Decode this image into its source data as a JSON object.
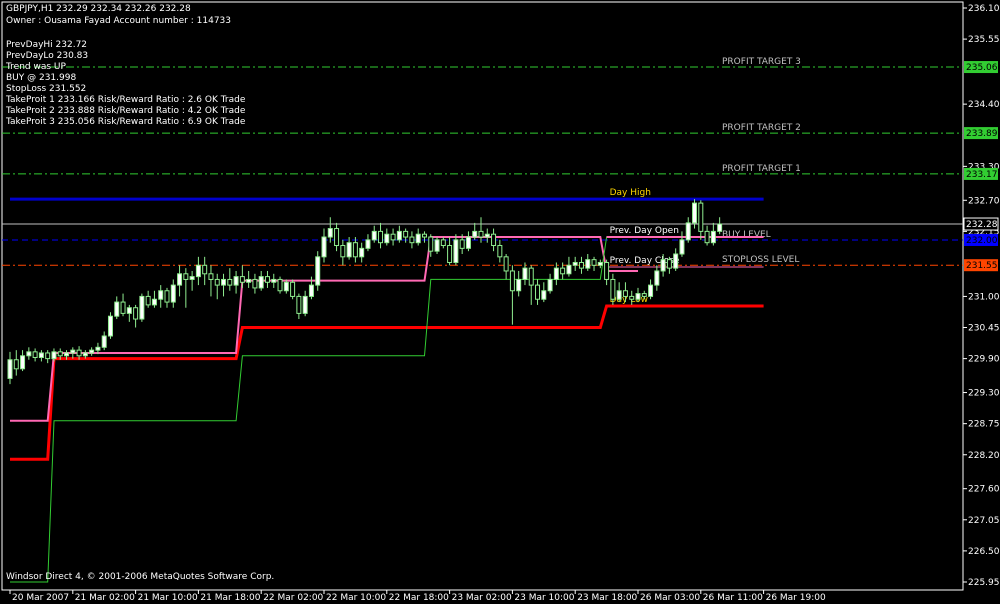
{
  "header": {
    "symbol_line": "GBPJPY,H1  232.29 232.34 232.26 232.28",
    "owner_line": "Owner : Ousama Fayad Account number : 114733",
    "info_lines": [
      "PrevDayHi 232.72",
      "PrevDayLo 230.83",
      "Trend was UP",
      "BUY @ 231.998",
      "StopLoss 231.552",
      "TakeProit 1 233.166 Risk/Reward Ratio : 2.6 OK Trade",
      "TakeProit 2 233.888 Risk/Reward Ratio : 4.2 OK Trade",
      "TakeProit 3 235.056 Risk/Reward Ratio : 6.9 OK Trade"
    ]
  },
  "footer": {
    "copyright": "Windsor Direct 4, © 2001-2006 MetaQuotes Software Corp."
  },
  "colors": {
    "background": "#000000",
    "axis": "#ffffff",
    "bull": "#90ee90",
    "bear": "#ffffff",
    "profit": "#32cd32",
    "day_high": "#0000cd",
    "buy": "#0000ff",
    "stoploss": "#ff4500",
    "day_low": "#ff0000",
    "prev_open": "#ff69b4",
    "prev_close": "#32cd32",
    "price_line": "#c0c0c0"
  },
  "chart_data": {
    "type": "candlestick",
    "symbol": "GBPJPY",
    "timeframe": "H1",
    "ylim": [
      225.95,
      236.1
    ],
    "y_ticks": [
      "236.10",
      "235.55",
      "234.40",
      "233.30",
      "232.70",
      "232.15",
      "231.00",
      "230.45",
      "229.90",
      "229.30",
      "228.75",
      "228.20",
      "227.60",
      "227.05",
      "226.50",
      "225.95"
    ],
    "x_ticks": [
      {
        "label": "20 Mar 2007",
        "bar": 0
      },
      {
        "label": "21 Mar 02:00",
        "bar": 10
      },
      {
        "label": "21 Mar 10:00",
        "bar": 20
      },
      {
        "label": "21 Mar 18:00",
        "bar": 30
      },
      {
        "label": "22 Mar 02:00",
        "bar": 40
      },
      {
        "label": "22 Mar 10:00",
        "bar": 50
      },
      {
        "label": "22 Mar 18:00",
        "bar": 60
      },
      {
        "label": "23 Mar 02:00",
        "bar": 70
      },
      {
        "label": "23 Mar 10:00",
        "bar": 80
      },
      {
        "label": "23 Mar 18:00",
        "bar": 90
      },
      {
        "label": "26 Mar 03:00",
        "bar": 100
      },
      {
        "label": "26 Mar 11:00",
        "bar": 110
      },
      {
        "label": "26 Mar 19:00",
        "bar": 120
      }
    ],
    "levels": [
      {
        "name": "PROFIT TARGET 3",
        "price": 235.056,
        "axis_label": "235.06",
        "color": "#32cd32",
        "style": "dashdot",
        "label_color": "#c0c0c0"
      },
      {
        "name": "PROFIT TARGET 2",
        "price": 233.888,
        "axis_label": "233.89",
        "color": "#32cd32",
        "style": "dashdot",
        "label_color": "#c0c0c0"
      },
      {
        "name": "PROFIT TARGET 1",
        "price": 233.166,
        "axis_label": "233.17",
        "color": "#32cd32",
        "style": "dashdot",
        "label_color": "#c0c0c0"
      },
      {
        "name": "BUY LEVEL",
        "price": 231.998,
        "axis_label": "232.00",
        "color": "#0000ff",
        "style": "dash",
        "label_color": "#c0c0c0"
      },
      {
        "name": "STOPLOSS LEVEL",
        "price": 231.552,
        "axis_label": "231.55",
        "color": "#ff4500",
        "style": "dashdot",
        "label_color": "#c0c0c0"
      }
    ],
    "current_price": {
      "price": 232.28,
      "label": "232.28"
    },
    "segments": [
      {
        "name": "Day High",
        "price": 232.72,
        "from_bar": 0,
        "to_bar": 120,
        "color": "#0000cd",
        "width": 3,
        "label_color": "#ffd700"
      },
      {
        "name": "Day Low",
        "price": 230.83,
        "from_bar": 95,
        "to_bar": 120,
        "color": "#ff0000",
        "width": 3,
        "label_color": "#ffd700"
      },
      {
        "name": "Prev. Day Open",
        "price": 232.05,
        "from_bar": 95,
        "to_bar": 120,
        "color": "#ff69b4",
        "width": 2,
        "label_color": "#ffffff"
      },
      {
        "name": "Prev. Day Close",
        "price": 231.52,
        "from_bar": 95,
        "to_bar": 120,
        "color": "#ff69b4",
        "width": 1,
        "label_color": "#ffffff"
      }
    ],
    "step_lines": [
      {
        "name": "Prev Day Low",
        "color": "#ff0000",
        "width": 3,
        "points": [
          [
            0,
            228.12
          ],
          [
            6,
            228.12
          ],
          [
            7,
            229.9
          ],
          [
            36,
            229.9
          ],
          [
            37,
            230.45
          ],
          [
            66,
            230.45
          ],
          [
            67,
            230.45
          ],
          [
            94,
            230.45
          ],
          [
            95,
            230.83
          ],
          [
            100,
            230.83
          ]
        ]
      },
      {
        "name": "Prev Day Open",
        "color": "#ff69b4",
        "width": 2,
        "points": [
          [
            0,
            228.8
          ],
          [
            6,
            228.8
          ],
          [
            7,
            230.0
          ],
          [
            36,
            230.0
          ],
          [
            37,
            231.28
          ],
          [
            66,
            231.28
          ],
          [
            67,
            232.05
          ],
          [
            94,
            232.05
          ],
          [
            95,
            231.45
          ],
          [
            100,
            231.45
          ]
        ]
      },
      {
        "name": "Prev Day Close",
        "color": "#32cd32",
        "width": 1,
        "points": [
          [
            0,
            225.95
          ],
          [
            6,
            225.95
          ],
          [
            7,
            228.8
          ],
          [
            36,
            228.8
          ],
          [
            37,
            229.95
          ],
          [
            66,
            229.95
          ],
          [
            67,
            231.3
          ],
          [
            94,
            231.3
          ],
          [
            95,
            232.05
          ],
          [
            100,
            232.05
          ]
        ]
      }
    ],
    "candles": [
      [
        229.55,
        229.88,
        229.45,
        230.02
      ],
      [
        229.88,
        229.72,
        229.6,
        230.05
      ],
      [
        229.72,
        229.95,
        229.68,
        230.05
      ],
      [
        229.95,
        230.02,
        229.88,
        230.1
      ],
      [
        230.02,
        229.92,
        229.85,
        230.08
      ],
      [
        229.92,
        230.0,
        229.85,
        230.05
      ],
      [
        230.0,
        229.9,
        229.82,
        230.05
      ],
      [
        229.9,
        230.02,
        229.85,
        230.08
      ],
      [
        230.02,
        229.95,
        229.88,
        230.08
      ],
      [
        229.95,
        230.0,
        229.88,
        230.05
      ],
      [
        230.0,
        230.05,
        229.9,
        230.1
      ],
      [
        230.05,
        229.95,
        229.88,
        230.12
      ],
      [
        229.95,
        230.0,
        229.9,
        230.05
      ],
      [
        230.0,
        230.05,
        229.95,
        230.1
      ],
      [
        230.05,
        230.1,
        229.98,
        230.18
      ],
      [
        230.1,
        230.3,
        230.05,
        230.38
      ],
      [
        230.3,
        230.65,
        230.25,
        230.72
      ],
      [
        230.65,
        230.9,
        230.6,
        231.0
      ],
      [
        230.9,
        230.7,
        230.65,
        231.05
      ],
      [
        230.7,
        230.8,
        230.55,
        230.85
      ],
      [
        230.8,
        230.6,
        230.45,
        230.85
      ],
      [
        230.6,
        231.0,
        230.55,
        231.05
      ],
      [
        231.0,
        230.85,
        230.8,
        231.1
      ],
      [
        230.85,
        230.95,
        230.8,
        231.1
      ],
      [
        230.95,
        231.1,
        230.8,
        231.2
      ],
      [
        231.1,
        230.9,
        230.8,
        231.15
      ],
      [
        230.9,
        231.2,
        230.8,
        231.3
      ],
      [
        231.2,
        231.4,
        231.0,
        231.55
      ],
      [
        231.4,
        231.3,
        230.8,
        231.5
      ],
      [
        231.3,
        231.35,
        231.1,
        231.45
      ],
      [
        231.35,
        231.55,
        231.2,
        231.7
      ],
      [
        231.55,
        231.4,
        231.2,
        231.7
      ],
      [
        231.4,
        231.3,
        231.0,
        231.55
      ],
      [
        231.3,
        231.2,
        230.95,
        231.4
      ],
      [
        231.2,
        231.3,
        231.0,
        231.4
      ],
      [
        231.3,
        231.2,
        231.1,
        231.5
      ],
      [
        231.2,
        231.35,
        231.05,
        231.45
      ],
      [
        231.35,
        231.25,
        231.15,
        231.55
      ],
      [
        231.25,
        231.3,
        231.15,
        231.45
      ],
      [
        231.3,
        231.15,
        231.05,
        231.4
      ],
      [
        231.15,
        231.35,
        231.1,
        231.45
      ],
      [
        231.35,
        231.25,
        231.15,
        231.45
      ],
      [
        231.25,
        231.3,
        231.15,
        231.4
      ],
      [
        231.3,
        231.1,
        231.05,
        231.35
      ],
      [
        231.1,
        231.25,
        231.05,
        231.3
      ],
      [
        231.25,
        231.0,
        230.95,
        231.3
      ],
      [
        231.0,
        230.7,
        230.6,
        231.05
      ],
      [
        230.7,
        231.0,
        230.65,
        231.1
      ],
      [
        231.0,
        231.2,
        230.95,
        231.35
      ],
      [
        231.2,
        231.7,
        231.1,
        231.8
      ],
      [
        231.7,
        232.05,
        231.6,
        232.2
      ],
      [
        232.05,
        232.2,
        231.95,
        232.4
      ],
      [
        232.2,
        231.9,
        231.8,
        232.3
      ],
      [
        231.9,
        231.7,
        231.55,
        232.0
      ],
      [
        231.7,
        231.95,
        231.65,
        232.05
      ],
      [
        231.95,
        231.7,
        231.6,
        232.05
      ],
      [
        231.7,
        231.85,
        231.6,
        231.95
      ],
      [
        231.85,
        232.0,
        231.8,
        232.1
      ],
      [
        232.0,
        232.15,
        231.95,
        232.25
      ],
      [
        232.15,
        231.95,
        231.85,
        232.3
      ],
      [
        231.95,
        232.1,
        231.9,
        232.2
      ],
      [
        232.1,
        232.0,
        231.9,
        232.2
      ],
      [
        232.0,
        232.15,
        231.95,
        232.25
      ],
      [
        232.15,
        232.05,
        231.95,
        232.2
      ],
      [
        232.05,
        231.95,
        231.85,
        232.15
      ],
      [
        231.95,
        232.1,
        231.9,
        232.2
      ],
      [
        232.1,
        232.05,
        231.95,
        232.15
      ],
      [
        232.05,
        231.8,
        231.7,
        232.1
      ],
      [
        231.8,
        232.0,
        231.75,
        232.05
      ],
      [
        232.0,
        231.9,
        231.85,
        232.05
      ],
      [
        231.9,
        231.6,
        231.55,
        232.05
      ],
      [
        231.6,
        232.0,
        231.55,
        232.1
      ],
      [
        232.0,
        231.85,
        231.75,
        232.1
      ],
      [
        231.85,
        232.05,
        231.8,
        232.15
      ],
      [
        232.05,
        232.15,
        232.0,
        232.3
      ],
      [
        232.15,
        232.05,
        231.95,
        232.4
      ],
      [
        232.05,
        232.1,
        231.95,
        232.2
      ],
      [
        232.1,
        231.9,
        231.8,
        232.2
      ],
      [
        231.9,
        231.7,
        231.6,
        232.0
      ],
      [
        231.7,
        231.45,
        231.3,
        231.75
      ],
      [
        231.45,
        231.1,
        230.5,
        231.55
      ],
      [
        231.1,
        231.3,
        231.0,
        231.45
      ],
      [
        231.3,
        231.5,
        231.2,
        231.6
      ],
      [
        231.5,
        231.2,
        230.85,
        231.55
      ],
      [
        231.2,
        230.95,
        230.85,
        231.3
      ],
      [
        230.95,
        231.1,
        230.9,
        231.25
      ],
      [
        231.1,
        231.3,
        231.05,
        231.4
      ],
      [
        231.3,
        231.5,
        231.2,
        231.6
      ],
      [
        231.5,
        231.4,
        231.3,
        231.6
      ],
      [
        231.4,
        231.55,
        231.35,
        231.7
      ],
      [
        231.55,
        231.6,
        231.45,
        231.7
      ],
      [
        231.6,
        231.5,
        231.4,
        231.7
      ],
      [
        231.5,
        231.65,
        231.45,
        231.75
      ],
      [
        231.65,
        231.55,
        231.45,
        231.7
      ],
      [
        231.55,
        231.6,
        231.5,
        231.65
      ],
      [
        231.6,
        231.3,
        231.2,
        231.65
      ],
      [
        231.3,
        230.95,
        230.85,
        231.4
      ],
      [
        230.95,
        231.1,
        230.9,
        231.25
      ],
      [
        231.1,
        231.0,
        230.9,
        231.25
      ],
      [
        231.0,
        230.95,
        230.85,
        231.1
      ],
      [
        230.95,
        231.05,
        230.9,
        231.15
      ],
      [
        231.05,
        231.0,
        230.95,
        231.1
      ],
      [
        231.0,
        231.2,
        230.95,
        231.3
      ],
      [
        231.2,
        231.45,
        231.1,
        231.55
      ],
      [
        231.45,
        231.65,
        231.35,
        231.75
      ],
      [
        231.65,
        231.5,
        231.4,
        231.7
      ],
      [
        231.5,
        231.75,
        231.45,
        231.85
      ],
      [
        231.75,
        232.0,
        231.7,
        232.15
      ],
      [
        232.0,
        232.3,
        231.95,
        232.4
      ],
      [
        232.3,
        232.65,
        232.2,
        232.72
      ],
      [
        232.65,
        232.15,
        232.0,
        232.7
      ],
      [
        232.15,
        231.95,
        231.9,
        232.25
      ],
      [
        231.95,
        232.15,
        231.9,
        232.3
      ],
      [
        232.15,
        232.28,
        232.1,
        232.4
      ]
    ]
  }
}
